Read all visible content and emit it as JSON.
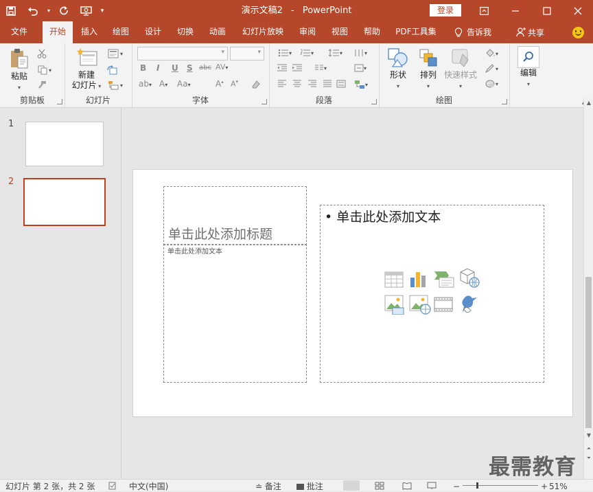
{
  "titlebar": {
    "doc_name": "演示文稿2",
    "separator": "-",
    "app_name": "PowerPoint",
    "login_label": "登录"
  },
  "tabs": [
    {
      "label": "文件",
      "active": false
    },
    {
      "label": "开始",
      "active": true
    },
    {
      "label": "插入",
      "active": false
    },
    {
      "label": "绘图",
      "active": false
    },
    {
      "label": "设计",
      "active": false
    },
    {
      "label": "切换",
      "active": false
    },
    {
      "label": "动画",
      "active": false
    },
    {
      "label": "幻灯片放映",
      "active": false
    },
    {
      "label": "审阅",
      "active": false
    },
    {
      "label": "视图",
      "active": false
    },
    {
      "label": "帮助",
      "active": false
    },
    {
      "label": "PDF工具集",
      "active": false
    }
  ],
  "tell_me": "告诉我",
  "share": "共享",
  "ribbon": {
    "clipboard": {
      "label": "剪贴板",
      "paste": "粘贴"
    },
    "slides": {
      "label": "幻灯片",
      "new_slide_line1": "新建",
      "new_slide_line2": "幻灯片"
    },
    "font": {
      "label": "字体"
    },
    "paragraph": {
      "label": "段落"
    },
    "drawing": {
      "label": "绘图",
      "shapes": "形状",
      "arrange": "排列",
      "quick_styles": "快速样式"
    },
    "editing": {
      "label": "编辑"
    }
  },
  "slides": [
    {
      "number": "1",
      "selected": false
    },
    {
      "number": "2",
      "selected": true
    }
  ],
  "current_slide": {
    "title_placeholder": "单击此处添加标题",
    "text_placeholder_small": "单击此处添加文本",
    "content_placeholder": "单击此处添加文本"
  },
  "statusbar": {
    "slide_info": "幻灯片 第 2 张，共 2 张",
    "language": "中文(中国)",
    "notes": "备注",
    "comments": "批注",
    "zoom": "51%"
  },
  "watermark": "最需教育",
  "colors": {
    "accent": "#b7472a",
    "ribbon_bg": "#f3f3f3",
    "selection": "#c43e1c"
  }
}
